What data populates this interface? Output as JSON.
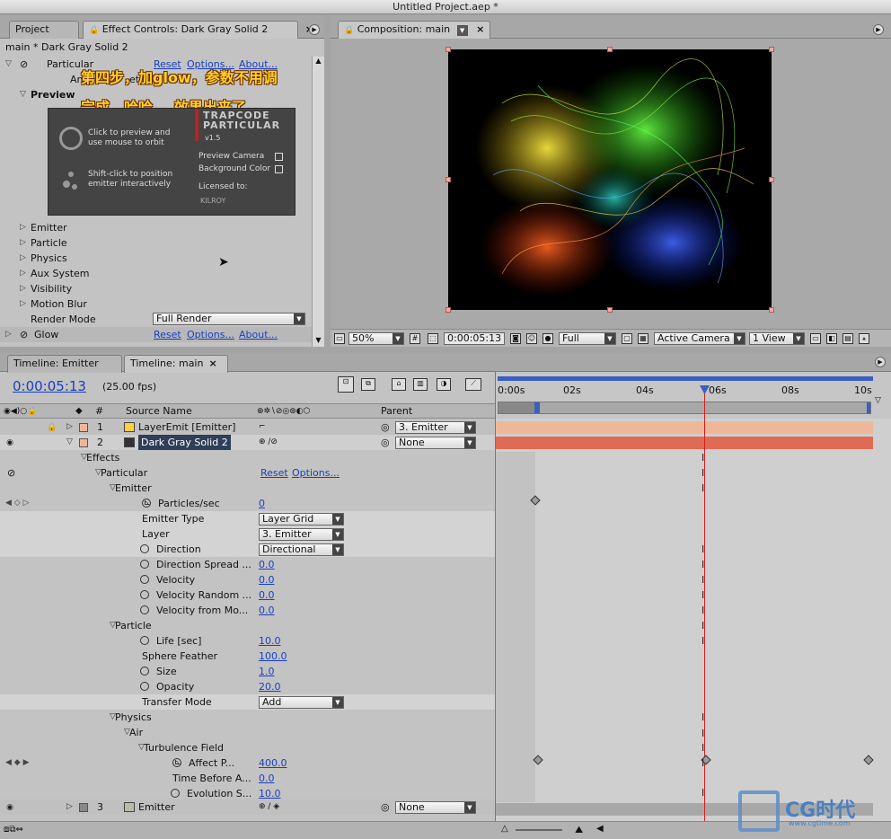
{
  "window": {
    "title": "Untitled Project.aep *"
  },
  "left_panel": {
    "tab_project": "Project",
    "tab_effect_controls": "Effect Controls: Dark Gray Solid 2",
    "breadcrumb": "main * Dark Gray Solid 2",
    "effect_name": "Particular",
    "reset": "Reset",
    "options": "Options...",
    "about": "About...",
    "animation_presets_partial": "Anim",
    "presets_suffix": "ets",
    "preview_label": "Preview",
    "overlay_line1": "第四步，加glow，参数不用调",
    "overlay_line2": "完成，哈哈。。效果出来了。。",
    "preview_box": {
      "click_text_1": "Click to preview and",
      "click_text_2": "use mouse to orbit",
      "shift_text_1": "Shift-click to position",
      "shift_text_2": "emitter interactively",
      "brand_1": "TRAPCODE",
      "brand_2": "PARTICULAR",
      "version": "v1.5",
      "preview_camera": "Preview Camera",
      "background_color": "Background Color",
      "licensed_to": "Licensed to:",
      "licensee": "KILROY"
    },
    "groups": [
      "Emitter",
      "Particle",
      "Physics",
      "Aux System",
      "Visibility",
      "Motion Blur"
    ],
    "render_mode_label": "Render Mode",
    "render_mode_value": "Full Render",
    "glow_label": "Glow"
  },
  "comp_panel": {
    "tab": "Composition: main",
    "zoom": "50%",
    "timecode": "0:00:05:13",
    "resolution": "Full",
    "camera": "Active Camera",
    "views": "1 View"
  },
  "timeline": {
    "tab_emitter": "Timeline: Emitter",
    "tab_main": "Timeline: main",
    "timecode": "0:00:05:13",
    "fps": "(25.00 fps)",
    "col_number": "#",
    "col_source": "Source Name",
    "col_parent": "Parent",
    "ruler": [
      "0:00s",
      "02s",
      "04s",
      "06s",
      "08s",
      "10s"
    ],
    "layers": [
      {
        "num": "1",
        "name": "LayerEmit [Emitter]",
        "parent": "3. Emitter"
      },
      {
        "num": "2",
        "name": "Dark Gray Solid 2",
        "parent": "None"
      },
      {
        "num": "3",
        "name": "Emitter",
        "parent": "None"
      }
    ],
    "effects_label": "Effects",
    "particular_label": "Particular",
    "reset": "Reset",
    "options": "Options...",
    "props": {
      "emitter": "Emitter",
      "particles_sec": "Particles/sec",
      "particles_sec_val": "0",
      "emitter_type": "Emitter Type",
      "emitter_type_val": "Layer Grid",
      "layer": "Layer",
      "layer_val": "3. Emitter",
      "direction": "Direction",
      "direction_val": "Directional",
      "direction_spread": "Direction Spread ...",
      "direction_spread_val": "0.0",
      "velocity": "Velocity",
      "velocity_val": "0.0",
      "velocity_random": "Velocity Random ...",
      "velocity_random_val": "0.0",
      "velocity_from": "Velocity from Mo...",
      "velocity_from_val": "0.0",
      "particle": "Particle",
      "life": "Life [sec]",
      "life_val": "10.0",
      "sphere_feather": "Sphere Feather",
      "sphere_feather_val": "100.0",
      "size": "Size",
      "size_val": "1.0",
      "opacity": "Opacity",
      "opacity_val": "20.0",
      "transfer_mode": "Transfer Mode",
      "transfer_mode_val": "Add",
      "physics": "Physics",
      "air": "Air",
      "turbulence_field": "Turbulence Field",
      "affect_p": "Affect P...",
      "affect_p_val": "400.0",
      "time_before": "Time Before A...",
      "time_before_val": "0.0",
      "evolution": "Evolution S...",
      "evolution_val": "10.0"
    }
  },
  "watermark": {
    "text": "CG时代",
    "url": "www.cgtime.com"
  },
  "colors": {
    "accent_link": "#1a3fbf",
    "playhead": "#d22020",
    "layer1_bar": "#efb79a",
    "layer2_bar": "#df6a55"
  }
}
